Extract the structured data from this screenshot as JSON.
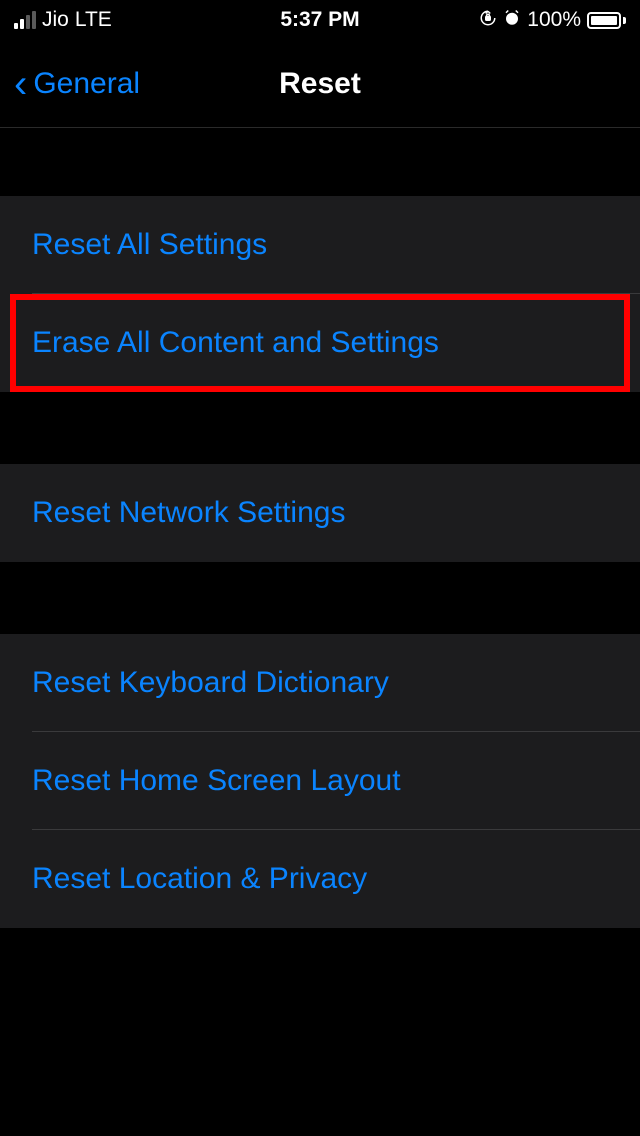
{
  "statusBar": {
    "carrier": "Jio",
    "network": "LTE",
    "time": "5:37 PM",
    "battery": "100%"
  },
  "nav": {
    "back": "General",
    "title": "Reset"
  },
  "cells": {
    "resetAllSettings": "Reset All Settings",
    "eraseAll": "Erase All Content and Settings",
    "resetNetwork": "Reset Network Settings",
    "resetKeyboard": "Reset Keyboard Dictionary",
    "resetHomeScreen": "Reset Home Screen Layout",
    "resetLocation": "Reset Location & Privacy"
  }
}
